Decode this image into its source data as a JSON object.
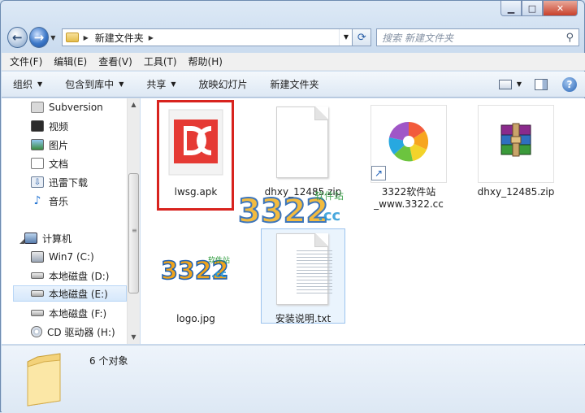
{
  "window": {
    "caption": {
      "min": "▁",
      "max": "□",
      "close": "✕"
    }
  },
  "address": {
    "crumb": "新建文件夹",
    "search_placeholder": "搜索 新建文件夹"
  },
  "menu": [
    "文件(F)",
    "编辑(E)",
    "查看(V)",
    "工具(T)",
    "帮助(H)"
  ],
  "commands": [
    {
      "label": "组织",
      "has_dropdown": true
    },
    {
      "label": "包含到库中",
      "has_dropdown": true
    },
    {
      "label": "共享",
      "has_dropdown": true
    },
    {
      "label": "放映幻灯片",
      "has_dropdown": false
    },
    {
      "label": "新建文件夹",
      "has_dropdown": false
    }
  ],
  "nav": {
    "favorites": [
      "Subversion",
      "视频",
      "图片",
      "文档",
      "迅雷下载",
      "音乐"
    ],
    "computer": "计算机",
    "drives": [
      "Win7 (C:)",
      "本地磁盘 (D:)",
      "本地磁盘 (E:)",
      "本地磁盘 (F:)",
      "CD 驱动器 (H:)"
    ],
    "selected": "本地磁盘 (E:)"
  },
  "files": [
    {
      "name": "lwsg.apk",
      "icon": "apk-app-icon",
      "selected": true
    },
    {
      "name": "dhxy_12485.zip",
      "icon": "blank-file-icon"
    },
    {
      "name": "3322软件站_www.3322.cc",
      "icon": "shortcut-pinwheel-icon"
    },
    {
      "name": "dhxy_12485.zip",
      "icon": "winrar-archive-icon"
    },
    {
      "name": "logo.jpg",
      "icon": "logo-image-icon"
    },
    {
      "name": "安装说明.txt",
      "icon": "text-file-icon",
      "highlighted": true
    }
  ],
  "watermark": {
    "brand": "3322",
    "tld": ".cc",
    "tag": "软件站"
  },
  "status": {
    "count": "6 个对象"
  },
  "colors": {
    "selection_red": "#d8231e",
    "accent_blue": "#2563b5"
  }
}
